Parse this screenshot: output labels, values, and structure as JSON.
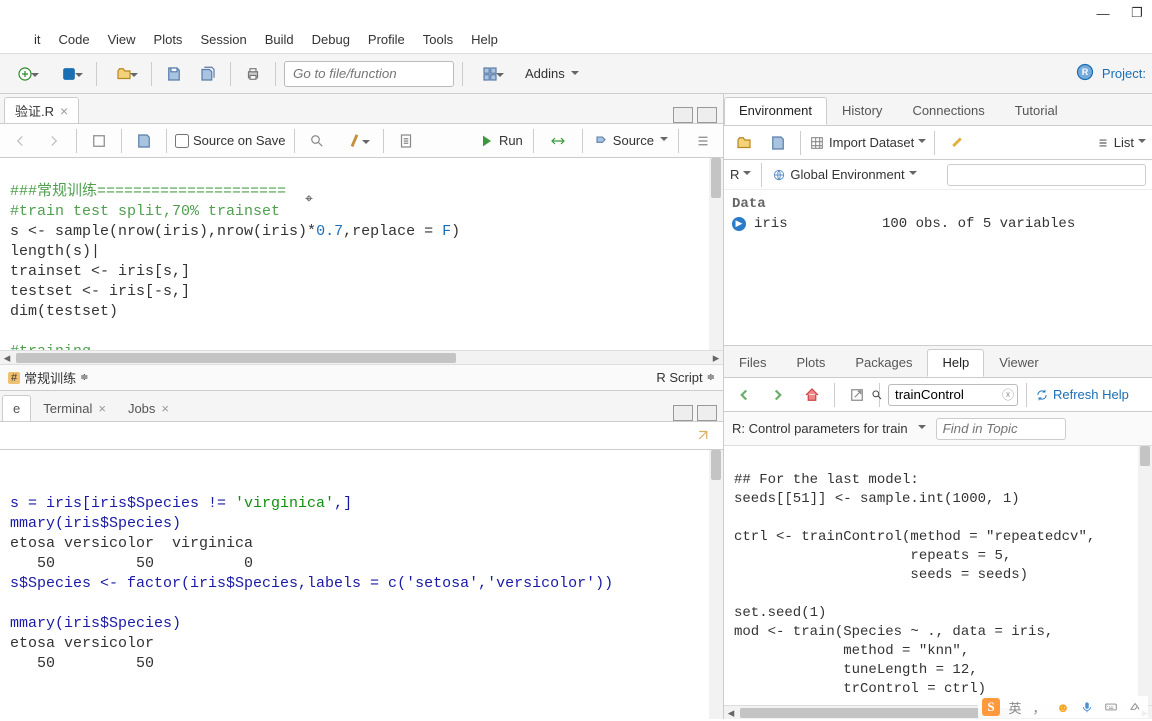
{
  "window": {
    "minimize": "—",
    "maximize": "❐"
  },
  "menu": [
    "it",
    "Code",
    "View",
    "Plots",
    "Session",
    "Build",
    "Debug",
    "Profile",
    "Tools",
    "Help"
  ],
  "toolbar": {
    "goto_placeholder": "Go to file/function",
    "addins": "Addins",
    "project": "Project:"
  },
  "source": {
    "tab_name": "验证.R",
    "source_on_save": "Source on Save",
    "run": "Run",
    "source_btn": "Source",
    "status_section": "常规训练",
    "status_right": "R Script",
    "code": {
      "l1": "###常规训练=====================",
      "l2": "#train test split,70% trainset",
      "l3a": "s <- sample(nrow(iris),nrow(iris)*",
      "l3b": "0.7",
      "l3c": ",replace = ",
      "l3d": "F",
      "l3e": ")",
      "l4": "length(s)|",
      "l5": "trainset <- iris[s,]",
      "l6": "testset <- iris[-s,]",
      "l7": "dim(testset)",
      "l8": "",
      "l9": "#training"
    }
  },
  "console": {
    "tabs": [
      "e",
      "Terminal",
      "Jobs"
    ],
    "lines": {
      "l1": "",
      "l2a": "s = iris[iris$Species != ",
      "l2b": "'virginica'",
      "l2c": ",]",
      "l3": "mmary(iris$Species)",
      "l4": "etosa versicolor  virginica ",
      "l5": "   50         50          0 ",
      "l6": "s$Species <- factor(iris$Species,labels = c('setosa','versicolor'))",
      "l7": "",
      "l8": "mmary(iris$Species)",
      "l9": "etosa versicolor ",
      "l10": "   50         50 "
    }
  },
  "env": {
    "tabs": [
      "Environment",
      "History",
      "Connections",
      "Tutorial"
    ],
    "import": "Import Dataset",
    "list": "List",
    "scope": "R",
    "global": "Global Environment",
    "data_hdr": "Data",
    "row": {
      "name": "iris",
      "desc": "100 obs. of 5 variables"
    }
  },
  "help": {
    "tabs": [
      "Files",
      "Plots",
      "Packages",
      "Help",
      "Viewer"
    ],
    "search_value": "trainControl",
    "refresh": "Refresh Help",
    "title": "R: Control parameters for train",
    "find_placeholder": "Find in Topic",
    "body": "\n## For the last model:\nseeds[[51]] <- sample.int(1000, 1)\n\nctrl <- trainControl(method = \"repeatedcv\",\n                     repeats = 5,\n                     seeds = seeds)\n\nset.seed(1)\nmod <- train(Species ~ ., data = iris,\n             method = \"knn\",\n             tuneLength = 12,\n             trControl = ctrl)\n"
  },
  "ime": {
    "lang": "英",
    "comma": "，",
    "smile": "☻"
  }
}
